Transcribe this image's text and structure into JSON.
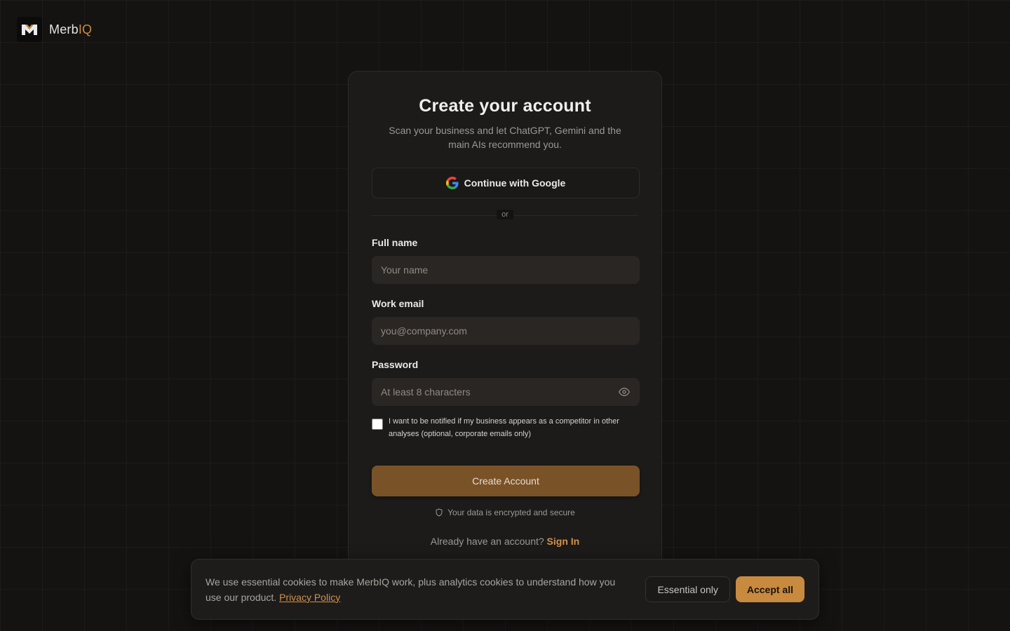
{
  "brand": {
    "name_prefix": "Merb",
    "name_accent": "IQ"
  },
  "signup": {
    "title": "Create your account",
    "subtitle": "Scan your business and let ChatGPT, Gemini and the main AIs recommend you.",
    "google_label": "Continue with Google",
    "divider_label": "or",
    "fields": {
      "name": {
        "label": "Full name",
        "placeholder": "Your name"
      },
      "email": {
        "label": "Work email",
        "placeholder": "you@company.com"
      },
      "password": {
        "label": "Password",
        "placeholder": "At least 8 characters"
      }
    },
    "notify_checkbox": {
      "checked": false,
      "label": "I want to be notified if my business appears as a competitor in other analyses (optional, corporate emails only)"
    },
    "submit_label": "Create Account",
    "secure_note": "Your data is encrypted and secure",
    "signin_prompt": "Already have an account?",
    "signin_link": "Sign In"
  },
  "cookie_banner": {
    "text": "We use essential cookies to make MerbIQ work, plus analytics cookies to understand how you use our product.",
    "policy_link": "Privacy Policy",
    "essential_label": "Essential only",
    "accept_label": "Accept all"
  },
  "colors": {
    "background": "#141312",
    "card": "#1c1b1a",
    "accent": "#c88a3f",
    "primary_button": "#7a5228",
    "link": "#d4924a"
  }
}
